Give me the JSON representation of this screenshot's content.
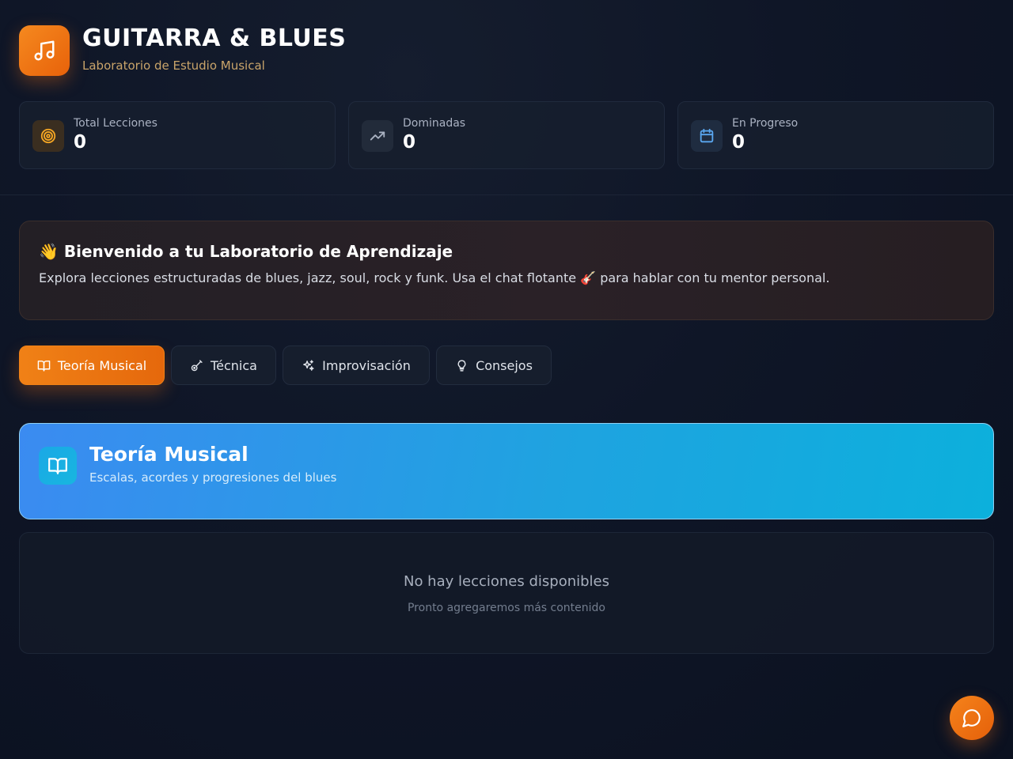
{
  "app": {
    "title": "GUITARRA & BLUES",
    "subtitle": "Laboratorio de Estudio Musical",
    "logo_icon": "music-note-icon",
    "accent": "#f08116"
  },
  "stats": [
    {
      "label": "Total Lecciones",
      "value": "0",
      "icon": "target-icon",
      "color": "#f5a623"
    },
    {
      "label": "Dominadas",
      "value": "0",
      "icon": "trending-up-icon",
      "color": "#9aa4b5"
    },
    {
      "label": "En Progreso",
      "value": "0",
      "icon": "calendar-icon",
      "color": "#5aa7f0"
    }
  ],
  "welcome": {
    "emoji": "👋",
    "title": "Bienvenido a tu Laboratorio de Aprendizaje",
    "text_before": "Explora lecciones estructuradas de blues, jazz, soul, rock y funk. Usa el chat flotante",
    "text_emoji": "🎸",
    "text_after": "para hablar con tu mentor personal."
  },
  "tabs": [
    {
      "label": "Teoría Musical",
      "icon": "book-open-icon",
      "active": true
    },
    {
      "label": "Técnica",
      "icon": "guitar-icon",
      "active": false
    },
    {
      "label": "Improvisación",
      "icon": "sparkles-icon",
      "active": false
    },
    {
      "label": "Consejos",
      "icon": "lightbulb-icon",
      "active": false
    }
  ],
  "section": {
    "title": "Teoría Musical",
    "subtitle": "Escalas, acordes y progresiones del blues",
    "icon": "book-open-icon",
    "color": "#1fa3e0"
  },
  "empty_state": {
    "title": "No hay lecciones disponibles",
    "subtitle": "Pronto agregaremos más contenido"
  },
  "chat": {
    "icon": "chat-bubble-icon"
  }
}
